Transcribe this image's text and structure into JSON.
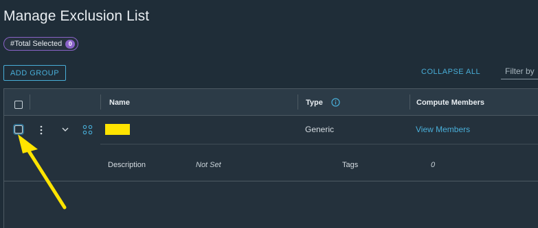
{
  "page": {
    "title": "Manage Exclusion List",
    "selected_pill": {
      "label": "#Total Selected",
      "count": "0"
    }
  },
  "toolbar": {
    "add_group_label": "ADD GROUP",
    "collapse_all_label": "COLLAPSE ALL",
    "filter_placeholder": "Filter by"
  },
  "table": {
    "columns": {
      "name": "Name",
      "type": "Type",
      "compute_members": "Compute Members"
    },
    "rows": [
      {
        "name": "",
        "type": "Generic",
        "compute_members_link": "View Members",
        "details": {
          "description_label": "Description",
          "description_value": "Not Set",
          "tags_label": "Tags",
          "tags_value": "0"
        }
      }
    ]
  },
  "colors": {
    "background": "#1f2d38",
    "accent": "#49afd9",
    "pill_border": "#8a63c8",
    "redaction": "#ffe400",
    "annotation_arrow": "#ffe400"
  },
  "icons": {
    "info": "info-icon",
    "row_menu": "kebab-menu-icon",
    "expand": "chevron-down-icon",
    "group": "group-icon",
    "annotation": "yellow-arrow-annotation"
  }
}
